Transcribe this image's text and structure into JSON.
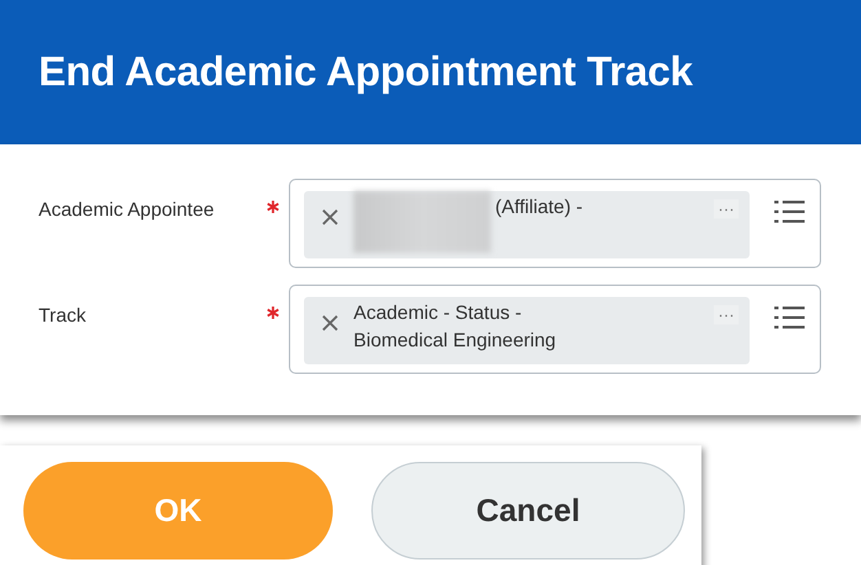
{
  "header": {
    "title": "End Academic Appointment Track"
  },
  "fields": [
    {
      "label": "Academic Appointee",
      "required": true,
      "value": {
        "redacted": true,
        "lines": [
          "(Affiliate) -"
        ]
      },
      "more": "···"
    },
    {
      "label": "Track",
      "required": true,
      "value": {
        "redacted": false,
        "lines": [
          "Academic - Status -",
          "Biomedical Engineering"
        ]
      },
      "more": "···"
    }
  ],
  "buttons": [
    {
      "label": "OK",
      "kind": "primary"
    },
    {
      "label": "Cancel",
      "kind": "secondary"
    }
  ]
}
